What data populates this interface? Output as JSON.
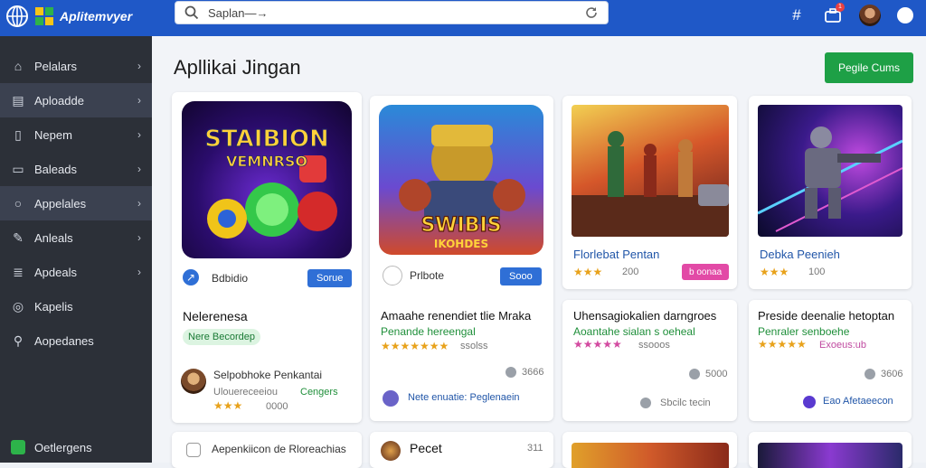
{
  "header": {
    "brand": "Aplitemvyer",
    "search_value": "Saplan—→",
    "notification_count": "1"
  },
  "sidebar": {
    "items": [
      {
        "label": "Pelalars",
        "icon": "home-icon"
      },
      {
        "label": "Aploadde",
        "icon": "apps-icon"
      },
      {
        "label": "Nepem",
        "icon": "document-icon"
      },
      {
        "label": "Baleads",
        "icon": "folder-icon"
      },
      {
        "label": "Appelales",
        "icon": "search-icon"
      },
      {
        "label": "Anleals",
        "icon": "edit-icon"
      },
      {
        "label": "Apdeals",
        "icon": "stack-icon"
      },
      {
        "label": "Kapelis",
        "icon": "settings-icon"
      },
      {
        "label": "Aopedanes",
        "icon": "user-search-icon"
      }
    ],
    "footer_label": "Oetlergens"
  },
  "main": {
    "title": "Apllikai Jingan",
    "primary_button": "Pegile Cums",
    "cards": [
      {
        "art_title": "STAIBION",
        "art_subtitle": "VEMNRSO",
        "small_label": "Bdbidio",
        "button": "Sorue",
        "title": "Nelerenesa",
        "tag": "Nere Becordep",
        "dev_name": "Selpobhoke Penkantai",
        "dev_sub": "Ulouereceeiou",
        "dev_green": "Cengers",
        "stars": "★★★",
        "meta": "0000"
      },
      {
        "art_title": "SWIBIS",
        "art_subtitle": "IKOHDES",
        "small_label": "Prlbote",
        "button": "Sooo",
        "title": "Amaahe renendiet tlie Mraka",
        "green": "Penande hereengal",
        "stars": "★★★★★★★",
        "rating_text": "ssolss",
        "count": "3666",
        "footer": "Nete enuatie: Peglenaein"
      },
      {
        "title": "Florlebat Pentan",
        "stars": "★★★",
        "count": "200",
        "pink_button": "b oonaa"
      },
      {
        "title": "Debka Peenieh",
        "stars": "★★★",
        "count": "100"
      },
      {
        "title": "Uhensagiokalien darngroes",
        "green": "Aoantahe sialan s oeheal",
        "stars": "★★★★★",
        "rating_text": "ssooos",
        "count": "5000",
        "footer": "Sbcilc tecin"
      },
      {
        "title": "Preside deenalie hetoptan",
        "green": "Penraler senboehe",
        "stars": "★★★★★",
        "rating_text": "Exoeus:ub",
        "count": "3606",
        "footer": "Eao Afetaeecon"
      }
    ],
    "bottom_row": [
      {
        "label": "Aepenkiicon de Rloreachias"
      },
      {
        "label": "Pecet",
        "meta": "311"
      }
    ]
  },
  "colors": {
    "topbar": "#1f58c7",
    "sidebar": "#2c3038",
    "accent_green": "#1ea046",
    "accent_blue": "#2f6fd6",
    "pink": "#e24aa6"
  }
}
